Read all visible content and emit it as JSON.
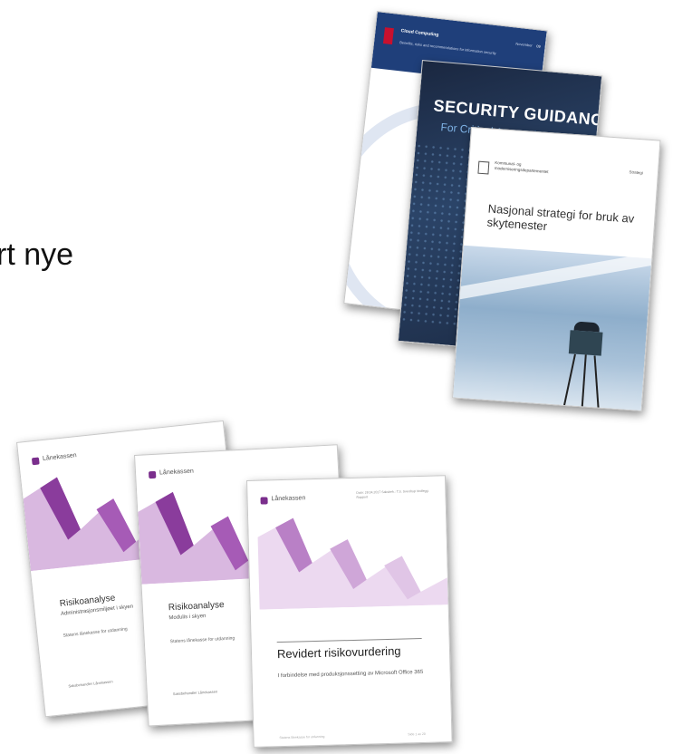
{
  "slide": {
    "visible_text": "rt nye"
  },
  "cover_cloud": {
    "title": "Cloud Computing",
    "subtitle": "Benefits, risks and recommendations for information security",
    "date": "November",
    "page": "09"
  },
  "cover_security": {
    "title": "SECURITY GUIDANCE",
    "subtitle": "For Critical Areas of Focus"
  },
  "cover_strategy": {
    "org_line1": "Kommunal- og",
    "org_line2": "moderniseringsdepartementet",
    "tag": "Strategi",
    "title": "Nasjonal strategi for bruk av skytenester"
  },
  "reports": [
    {
      "brand": "Lånekassen",
      "title": "Risikoanalyse",
      "subtitle": "Administrasjonsmiljøet i skyen",
      "line": "Statens lånekasse for utdanning",
      "footer": "Saksbehandler Lånekassen"
    },
    {
      "brand": "Lånekassen",
      "title": "Risikoanalyse",
      "subtitle": "Modulis i skyen",
      "line": "Statens lånekasse for utdanning",
      "footer": "Saksbehandler Lånekassen"
    },
    {
      "brand": "Lånekassen",
      "meta": "Dato: 28.04.2017 Saksbeh.: T.S. Sverdrup Vedlegg: Rapport",
      "title": "Revidert risikovurdering",
      "description": "I forbindelse med produksjonssetting av Microsoft Office 365",
      "footer_left": "Statens lånekasse for utdanning",
      "footer_right": "Side 1 av 20"
    }
  ],
  "colors": {
    "lanekassen_purple": "#7a2e8c",
    "cloud_blue": "#1f3f7a",
    "security_navy": "#1a2740"
  }
}
